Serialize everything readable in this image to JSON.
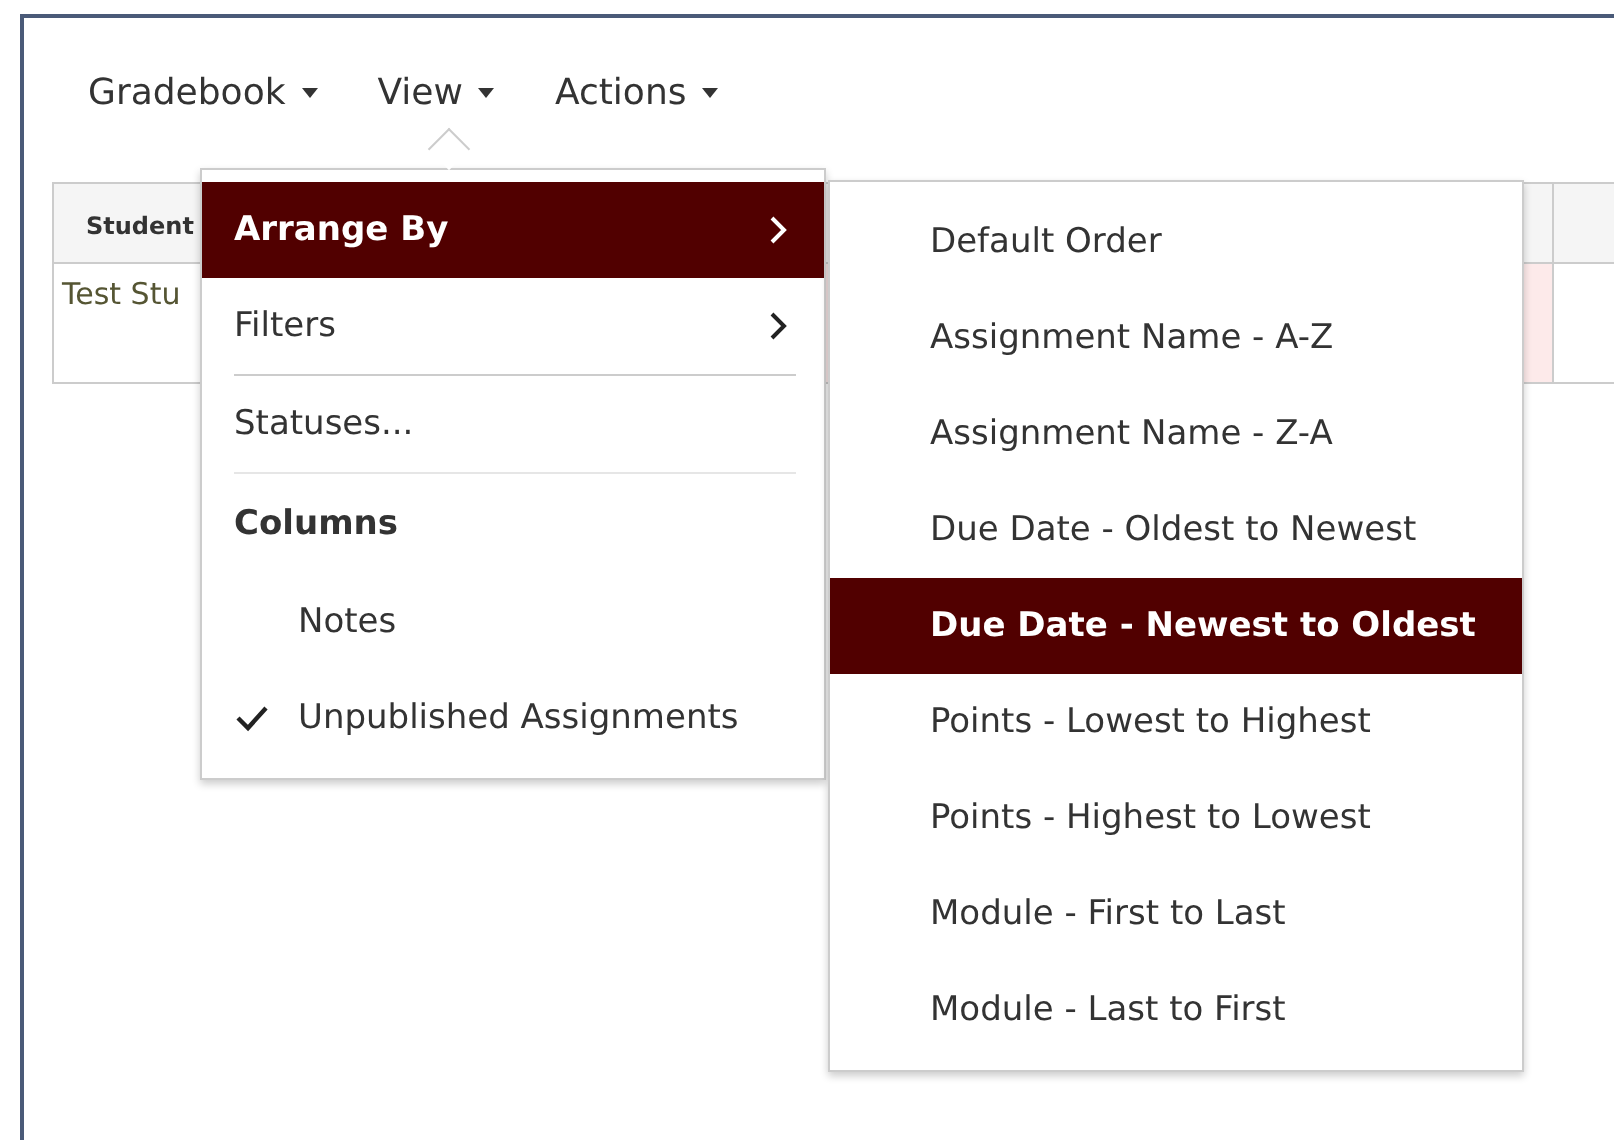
{
  "toolbar": [
    {
      "label": "Gradebook",
      "open": false
    },
    {
      "label": "View",
      "open": true
    },
    {
      "label": "Actions",
      "open": false
    }
  ],
  "table": {
    "columns": [
      "Student"
    ],
    "rows": [
      [
        "Test Stu"
      ]
    ]
  },
  "view_menu": [
    {
      "kind": "submenu",
      "label": "Arrange By",
      "selected": true
    },
    {
      "kind": "submenu",
      "label": "Filters",
      "selected": false
    },
    {
      "kind": "item",
      "label": "Statuses..."
    },
    {
      "kind": "header",
      "label": "Columns"
    },
    {
      "kind": "check",
      "label": "Notes",
      "checked": false
    },
    {
      "kind": "check",
      "label": "Unpublished Assignments",
      "checked": true
    }
  ],
  "arrange_menu": [
    {
      "label": "Default Order",
      "selected": false
    },
    {
      "label": "Assignment Name - A-Z",
      "selected": false
    },
    {
      "label": "Assignment Name - Z-A",
      "selected": false
    },
    {
      "label": "Due Date - Oldest to Newest",
      "selected": false
    },
    {
      "label": "Due Date - Newest to Oldest",
      "selected": true
    },
    {
      "label": "Points - Lowest to Highest",
      "selected": false
    },
    {
      "label": "Points - Highest to Lowest",
      "selected": false
    },
    {
      "label": "Module - First to Last",
      "selected": false
    },
    {
      "label": "Module - Last to First",
      "selected": false
    }
  ]
}
